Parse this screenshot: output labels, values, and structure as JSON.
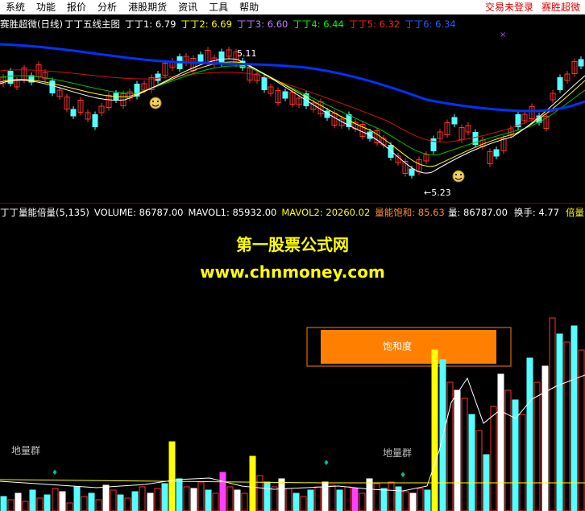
{
  "menu": {
    "items": [
      "系统",
      "功能",
      "报价",
      "分析",
      "港股期货",
      "资讯",
      "工具",
      "帮助"
    ],
    "login_status": "交易未登录",
    "app_name": "赛胜超微"
  },
  "price_panel": {
    "title": "赛胜超微(日线)",
    "indicator_name": "丁丁五线主图",
    "lines": [
      {
        "label": "丁丁1: 6.79",
        "color": "#ffffff"
      },
      {
        "label": "丁丁2: 6.69",
        "color": "#ffff00"
      },
      {
        "label": "丁丁3: 6.60",
        "color": "#c080ff"
      },
      {
        "label": "丁丁4: 6.44",
        "color": "#00ff00"
      },
      {
        "label": "丁丁5: 6.32",
        "color": "#ff2020"
      },
      {
        "label": "丁丁6: 6.34",
        "color": "#2060ff"
      }
    ],
    "high_label": "5.11",
    "low_label": "←5.23"
  },
  "volume_panel": {
    "title": "丁丁量能倍量(5,135)",
    "volume": "VOLUME: 86787.00",
    "mavol1": "MAVOL1: 85932.00",
    "mavol2": "MAVOL2: 20260.02",
    "saturation": "量能饱和: 85.63",
    "right_vol": "量: 86787.00",
    "turnover": "换手: 4.77",
    "multiple": "倍量:",
    "label_left": "地量群",
    "label_right": "地量群",
    "saturation_box": "饱和度"
  },
  "watermark": {
    "line1": "第一股票公式网",
    "line2": "www.chnmoney.com"
  },
  "colors": {
    "up": "#ff3030",
    "down": "#54ffff",
    "blue_line": "#0033ff",
    "bg": "#000000"
  }
}
